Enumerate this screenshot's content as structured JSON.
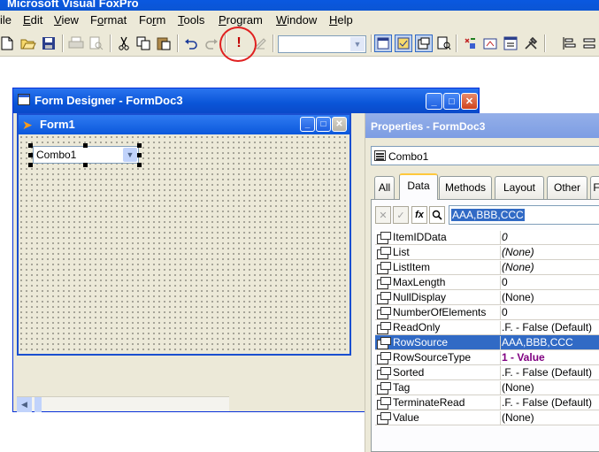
{
  "app": {
    "title": "Microsoft Visual FoxPro"
  },
  "menu": [
    {
      "label": "ile",
      "underline": ""
    },
    {
      "label": "Edit",
      "underline": "E"
    },
    {
      "label": "View",
      "underline": "V"
    },
    {
      "label": "Format",
      "underline": "o"
    },
    {
      "label": "Form",
      "underline": "r"
    },
    {
      "label": "Tools",
      "underline": "T"
    },
    {
      "label": "Program",
      "underline": "P"
    },
    {
      "label": "Window",
      "underline": "W"
    },
    {
      "label": "Help",
      "underline": "H"
    }
  ],
  "toolbar": {
    "icons": [
      "new-icon",
      "open-icon",
      "save-icon",
      "print-icon",
      "print-preview-icon",
      "cut-icon",
      "copy-icon",
      "paste-icon",
      "undo-icon",
      "redo-icon",
      "run-icon",
      "modify-form-icon",
      "form-layout-icon",
      "form-control-icon",
      "properties-icon",
      "code-icon",
      "toolbox-icon",
      "builder-icon",
      "tools-icon",
      "align-icon"
    ],
    "run_glyph": "!",
    "combo_value": ""
  },
  "form_designer": {
    "title": "Form Designer - FormDoc3",
    "form": {
      "title": "Form1",
      "combo_label": "Combo1"
    }
  },
  "properties": {
    "title": "Properties - FormDoc3",
    "object": "Combo1",
    "tabs": [
      {
        "label": "All",
        "active": false
      },
      {
        "label": "Data",
        "active": true
      },
      {
        "label": "Methods",
        "active": false
      },
      {
        "label": "Layout",
        "active": false
      },
      {
        "label": "Other",
        "active": false
      },
      {
        "label": "F",
        "active": false
      }
    ],
    "edit_value": "AAA,BBB,CCC",
    "rows": [
      {
        "name": "ItemIDData",
        "value": "0",
        "style": "it"
      },
      {
        "name": "List",
        "value": "(None)",
        "style": "it"
      },
      {
        "name": "ListItem",
        "value": "(None)",
        "style": "it"
      },
      {
        "name": "MaxLength",
        "value": "0",
        "style": ""
      },
      {
        "name": "NullDisplay",
        "value": "(None)",
        "style": ""
      },
      {
        "name": "NumberOfElements",
        "value": "0",
        "style": ""
      },
      {
        "name": "ReadOnly",
        "value": ".F. - False (Default)",
        "style": ""
      },
      {
        "name": "RowSource",
        "value": "AAA,BBB,CCC",
        "style": "",
        "selected": true
      },
      {
        "name": "RowSourceType",
        "value": "1 - Value",
        "style": "bold"
      },
      {
        "name": "Sorted",
        "value": ".F. - False (Default)",
        "style": ""
      },
      {
        "name": "Tag",
        "value": "(None)",
        "style": ""
      },
      {
        "name": "TerminateRead",
        "value": ".F. - False (Default)",
        "style": ""
      },
      {
        "name": "Value",
        "value": "(None)",
        "style": ""
      }
    ]
  },
  "colors": {
    "xp_title": "#0a55d8",
    "selection": "#316ac5",
    "highlight_circle": "#e02020",
    "rowsourcetype_value": "#800080"
  }
}
